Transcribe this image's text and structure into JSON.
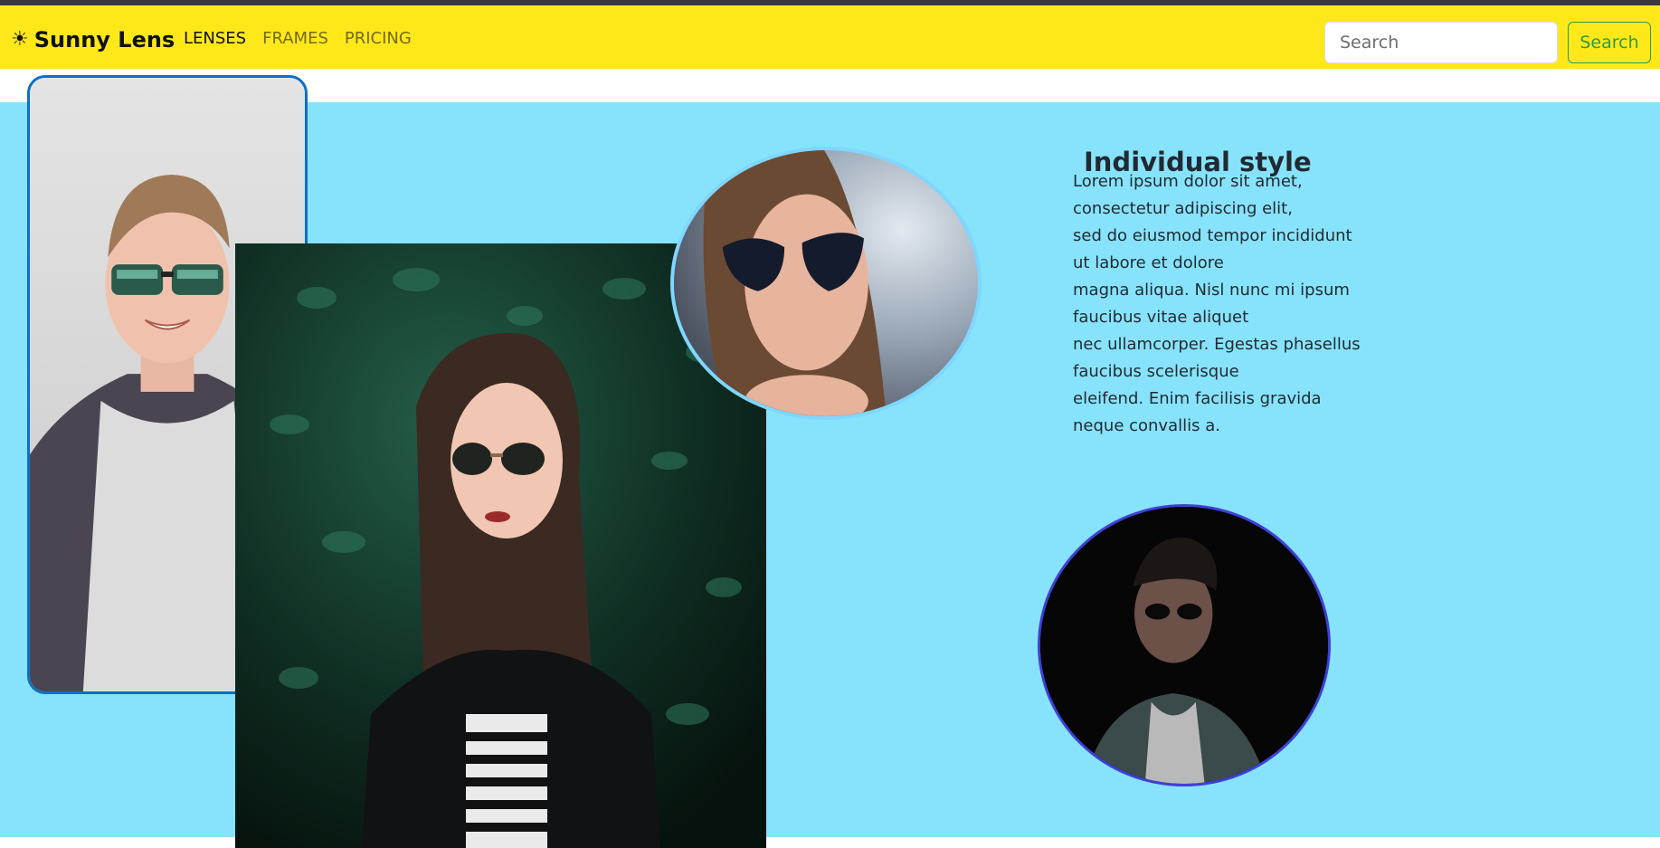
{
  "navbar": {
    "brand": {
      "icon": "sun-icon",
      "icon_glyph": "☀",
      "name": "Sunny Lens"
    },
    "links": [
      {
        "label": "LENSES",
        "active": true
      },
      {
        "label": "FRAMES",
        "active": false
      },
      {
        "label": "PRICING",
        "active": false
      }
    ],
    "search": {
      "placeholder": "Search",
      "value": "",
      "button_label": "Search"
    },
    "colors": {
      "background": "#ffe81a",
      "search_button": "#2e9a44"
    }
  },
  "hero": {
    "background_color": "#87e3fb",
    "heading": "Individual style",
    "paragraph_lines": [
      "Lorem ipsum dolor sit amet,",
      "consectetur adipiscing elit,",
      "sed do eiusmod tempor incididunt",
      "ut labore et dolore",
      "magna aliqua. Nisl nunc mi ipsum",
      "faucibus vitae aliquet",
      "nec ullamcorper. Egestas phasellus",
      "faucibus scelerisque",
      "eleifend. Enim facilisis gravida",
      "neque convallis a."
    ]
  }
}
